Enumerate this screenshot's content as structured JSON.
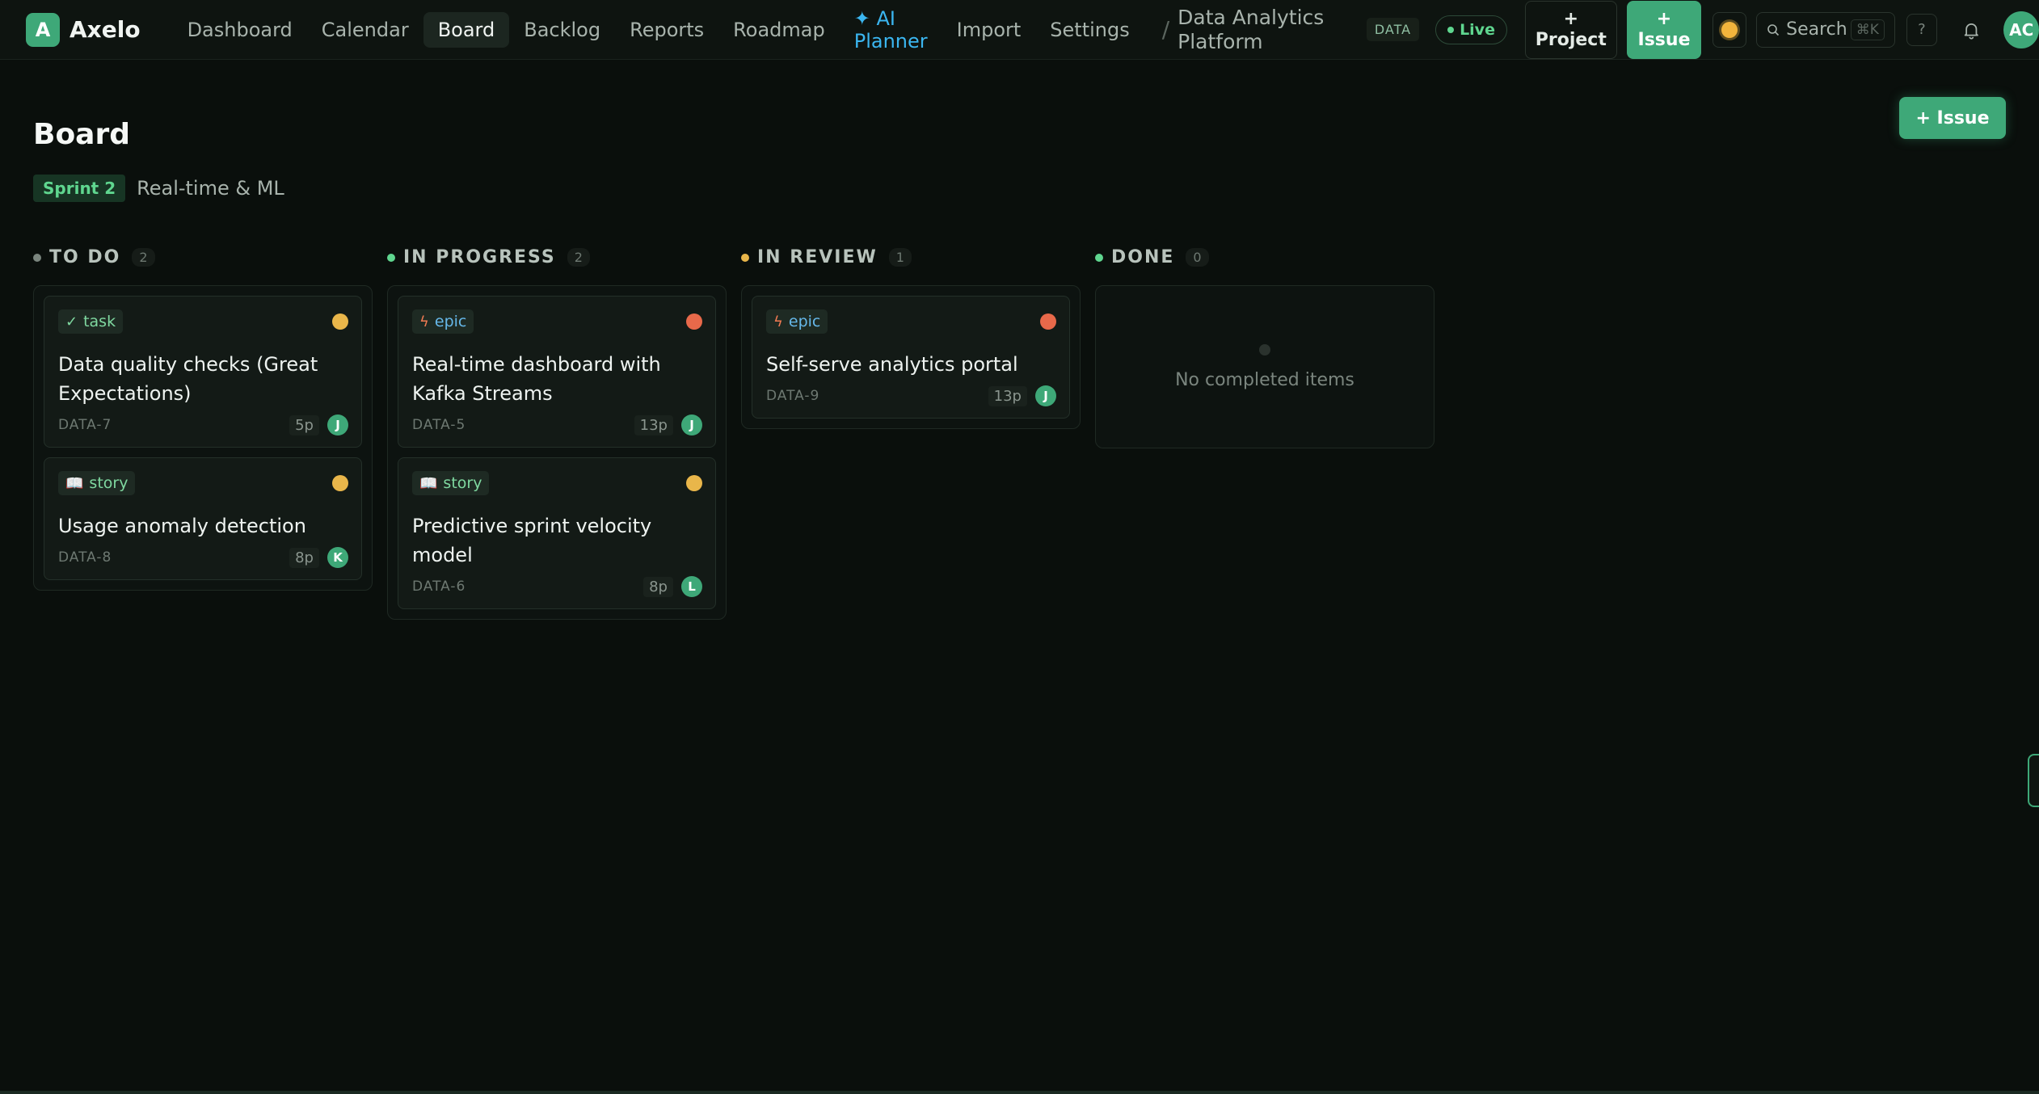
{
  "app": {
    "logo_letter": "A",
    "name": "Axelo"
  },
  "nav": {
    "items": [
      "Dashboard",
      "Calendar",
      "Board",
      "Backlog",
      "Reports",
      "Roadmap"
    ],
    "ai_planner_line1": "✦ AI",
    "ai_planner_line2": "Planner",
    "import": "Import",
    "settings": "Settings",
    "active": "Board"
  },
  "project": {
    "separator": "/",
    "name_line1": "Data Analytics",
    "name_line2": "Platform",
    "key": "DATA",
    "status": "Live"
  },
  "toolbar": {
    "new_project_plus": "+",
    "new_project_label": "Project",
    "new_issue_plus": "+",
    "new_issue_label": "Issue",
    "theme_icon": "sun-icon",
    "search_placeholder": "Search",
    "search_shortcut": "⌘K",
    "help_label": "?",
    "user_initials": "AC"
  },
  "page": {
    "title": "Board",
    "sprint_badge": "Sprint 2",
    "sprint_name": "Real-time & ML",
    "add_issue_button": "+ Issue"
  },
  "colors": {
    "accent": "#3ea878",
    "todo": "#7a857e",
    "in_progress": "#5fd68f",
    "in_review": "#e9b64a",
    "done": "#5fd68f",
    "priority_medium": "#e9b64a",
    "priority_high": "#e8694a"
  },
  "columns": [
    {
      "title": "TO DO",
      "count": "2",
      "cards": [
        {
          "type": "task",
          "type_icon": "✓",
          "title": "Data quality checks (Great Expectations)",
          "key": "DATA-7",
          "points": "5p",
          "assignee": "J",
          "priority": "medium"
        },
        {
          "type": "story",
          "type_icon": "📖",
          "title": "Usage anomaly detection",
          "key": "DATA-8",
          "points": "8p",
          "assignee": "K",
          "priority": "medium"
        }
      ]
    },
    {
      "title": "IN PROGRESS",
      "count": "2",
      "cards": [
        {
          "type": "epic",
          "type_icon": "ϟ",
          "title": "Real-time dashboard with Kafka Streams",
          "key": "DATA-5",
          "points": "13p",
          "assignee": "J",
          "priority": "high"
        },
        {
          "type": "story",
          "type_icon": "📖",
          "title": "Predictive sprint velocity model",
          "key": "DATA-6",
          "points": "8p",
          "assignee": "L",
          "priority": "medium"
        }
      ]
    },
    {
      "title": "IN REVIEW",
      "count": "1",
      "cards": [
        {
          "type": "epic",
          "type_icon": "ϟ",
          "title": "Self-serve analytics portal",
          "key": "DATA-9",
          "points": "13p",
          "assignee": "J",
          "priority": "high"
        }
      ]
    },
    {
      "title": "DONE",
      "count": "0",
      "empty_text": "No completed items"
    }
  ]
}
